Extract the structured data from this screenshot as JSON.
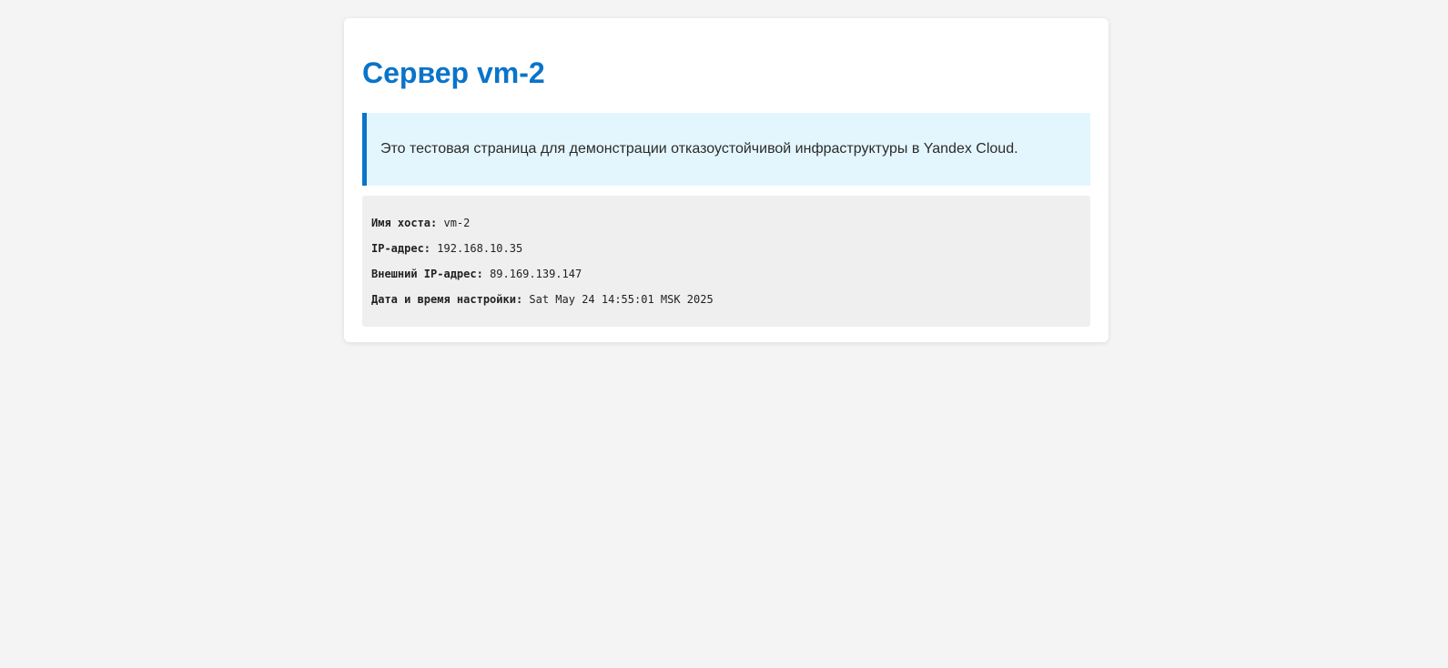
{
  "page": {
    "title": "Сервер vm-2",
    "description": "Это тестовая страница для демонстрации отказоустойчивой инфраструктуры в Yandex Cloud.",
    "details": {
      "hostname_label": "Имя хоста:",
      "hostname_value": "vm-2",
      "ip_label": "IP-адрес:",
      "ip_value": "192.168.10.35",
      "external_ip_label": "Внешний IP-адрес:",
      "external_ip_value": "89.169.139.147",
      "setup_date_label": "Дата и время настройки:",
      "setup_date_value": "Sat May 24 14:55:01 MSK 2025"
    }
  },
  "colors": {
    "accent": "#0a74c9",
    "info_background": "#e4f6fd",
    "details_background": "#efefef",
    "page_background": "#f4f4f4"
  }
}
